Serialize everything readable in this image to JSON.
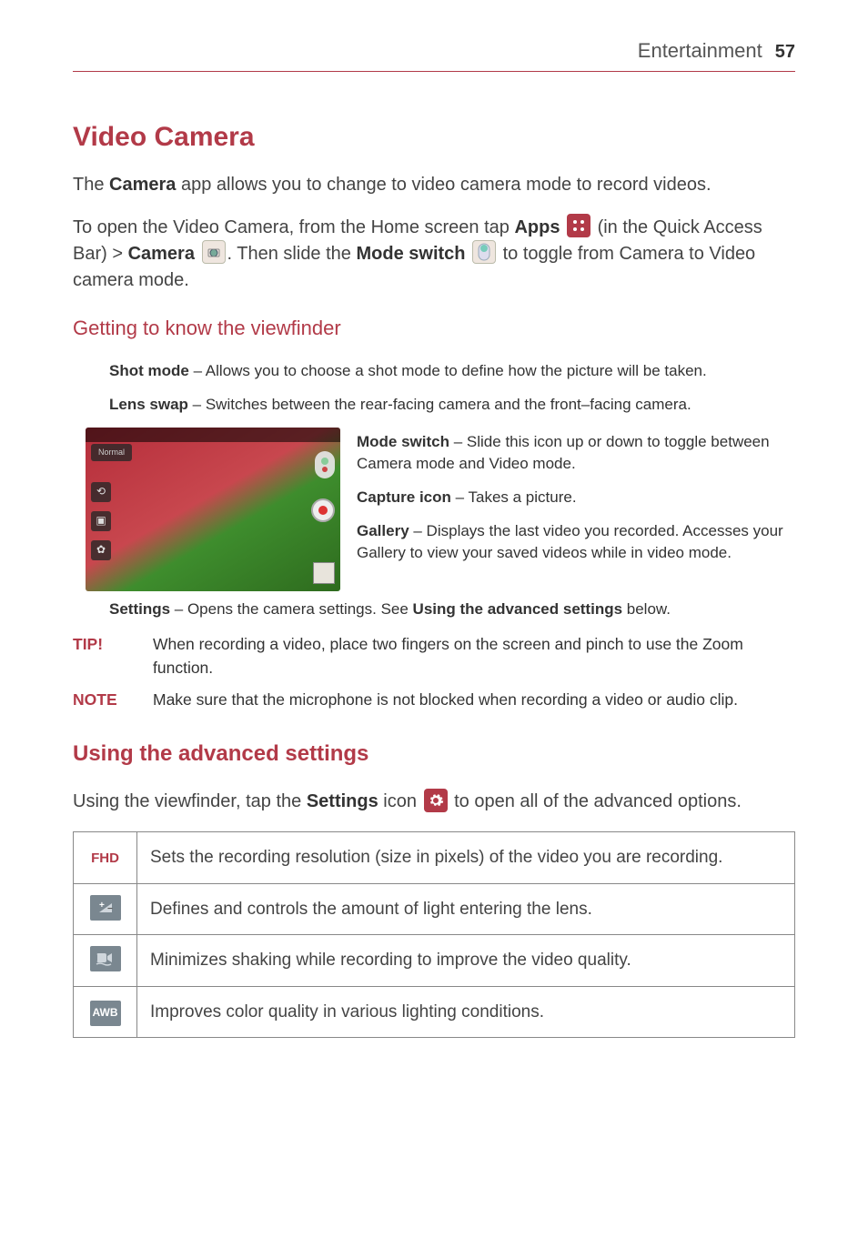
{
  "header": {
    "section": "Entertainment",
    "page": "57"
  },
  "title": "Video Camera",
  "intro": {
    "p1_pre": "The ",
    "p1_bold": "Camera",
    "p1_post": " app allows you to change to video camera mode to record videos.",
    "p2_a": "To open the Video Camera, from the Home screen tap ",
    "p2_apps": "Apps",
    "p2_b": " (in the Quick Access Bar) > ",
    "p2_camera": "Camera",
    "p2_c": ". Then slide the ",
    "p2_mode": "Mode switch",
    "p2_d": " to toggle from Camera to Video camera mode."
  },
  "viewfinder": {
    "heading": "Getting to know the viewfinder",
    "normal_label": "Normal",
    "items": [
      {
        "name": "Shot mode",
        "desc": " – Allows you to choose a shot mode to define how the picture will be taken."
      },
      {
        "name": "Lens swap",
        "desc": " – Switches between the rear-facing camera and the front–facing camera."
      },
      {
        "name": "Mode switch",
        "desc": " – Slide this icon up or down to toggle between Camera mode and Video mode."
      },
      {
        "name": "Capture icon",
        "desc": " – Takes a picture."
      },
      {
        "name": "Gallery",
        "desc": " – Displays the last video you recorded. Accesses your Gallery to view your saved videos while in video mode."
      },
      {
        "name": "Settings",
        "desc_pre": " – Opens the camera settings. See ",
        "desc_bold": "Using the advanced settings",
        "desc_post": " below."
      }
    ]
  },
  "tip": {
    "label": "TIP!",
    "text": "When recording a video, place two fingers on the screen and pinch to use the Zoom function."
  },
  "note": {
    "label": "NOTE",
    "text": "Make sure that the microphone is not blocked when recording a video or audio clip."
  },
  "advanced": {
    "heading": "Using the advanced settings",
    "intro_a": "Using the viewfinder, tap the ",
    "intro_bold": "Settings",
    "intro_b": " icon ",
    "intro_c": " to open all of the advanced options.",
    "rows": [
      {
        "icon": "FHD",
        "text": "Sets the recording resolution (size in pixels) of the video you are recording."
      },
      {
        "icon": "brightness",
        "text": "Defines and controls the amount of light entering the lens."
      },
      {
        "icon": "stabilize",
        "text": "Minimizes shaking while recording to improve the video quality."
      },
      {
        "icon": "AWB",
        "text": "Improves color quality in various lighting conditions."
      }
    ]
  }
}
